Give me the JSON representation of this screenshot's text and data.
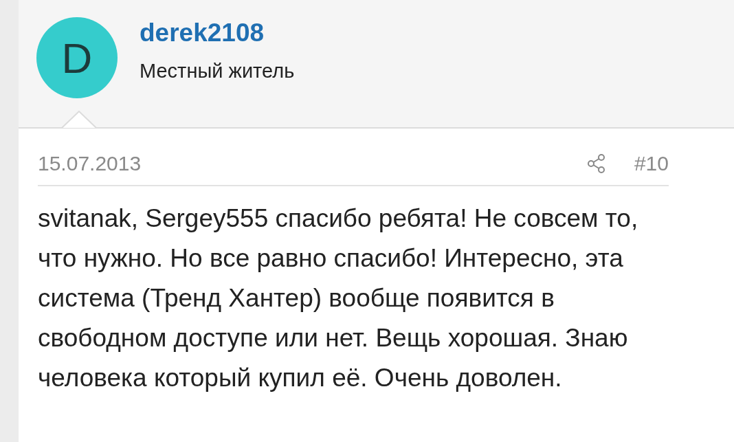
{
  "author": {
    "avatar_letter": "D",
    "username": "derek2108",
    "title": "Местный житель"
  },
  "post": {
    "date": "15.07.2013",
    "number": "#10",
    "body": "svitanak, Sergey555 спасибо ребята! Не совсем то, что нужно. Но все равно спасибо! Интересно, эта система (Тренд Хантер) вообще появится в свободном доступе или нет. Вещь хорошая. Знаю человека который купил её. Очень доволен."
  }
}
